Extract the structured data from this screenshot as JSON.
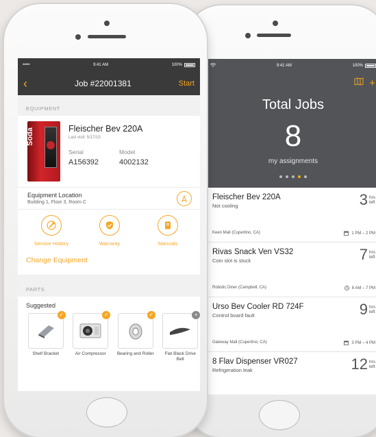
{
  "left_phone": {
    "status": {
      "signal": "••••• ",
      "time": "9:41 AM",
      "battery": "100%"
    },
    "nav": {
      "back": "‹",
      "title": "Job #22001381",
      "action": "Start"
    },
    "equipment_section": "EQUIPMENT",
    "equipment": {
      "name": "Fleischer Bev 220A",
      "last_visit": "Last visit: 5/17/15",
      "serial_label": "Serial",
      "serial": "A156392",
      "model_label": "Model",
      "model": "4002132",
      "image_label": "Soda"
    },
    "location": {
      "title": "Equipment Location",
      "address": "Building 1, Floor 3, Room C"
    },
    "actions": [
      {
        "label": "Service History",
        "icon": "wrench-icon"
      },
      {
        "label": "Warranty",
        "icon": "shield-icon"
      },
      {
        "label": "Manuals",
        "icon": "book-icon"
      }
    ],
    "change_equipment": "Change Equipment",
    "parts_section": "PARTS",
    "suggested": "Suggested",
    "parts": [
      {
        "name": "Shelf Bracket"
      },
      {
        "name": "Air Compressor"
      },
      {
        "name": "Bearing and Roller"
      },
      {
        "name": "Flat Black Drive Belt"
      }
    ],
    "accent": "#f5a623"
  },
  "right_phone": {
    "status": {
      "time": "9:41 AM",
      "battery": "100%"
    },
    "header": {
      "title": "Total Jobs",
      "count": "8",
      "subtitle": "my assignments",
      "plus": "+"
    },
    "jobs": [
      {
        "title": "Fleischer Bev 220A",
        "desc": "Not cooling",
        "hours": "3",
        "unit_top": "hrs",
        "unit_bottom": "left",
        "place": "Keen Mall (Cupertino, CA)",
        "time": "1 PM – 2 PM"
      },
      {
        "title": "Rivas Snack Ven VS32",
        "desc": "Coin slot is stuck",
        "hours": "7",
        "unit_top": "hrs",
        "unit_bottom": "left",
        "place": "Robotic Diner (Campbell, CA)",
        "time": "8 AM – 7 PM"
      },
      {
        "title": "Urso Bev Cooler RD 724F",
        "desc": "Control board fault",
        "hours": "9",
        "unit_top": "hrs",
        "unit_bottom": "left",
        "place": "Gateway Mall (Cupertino, CA)",
        "time": "3 PM – 4 PM"
      },
      {
        "title": "8 Flav Dispenser VR027",
        "desc": "Refrigeration leak",
        "hours": "12",
        "unit_top": "hrs",
        "unit_bottom": "left"
      }
    ]
  }
}
